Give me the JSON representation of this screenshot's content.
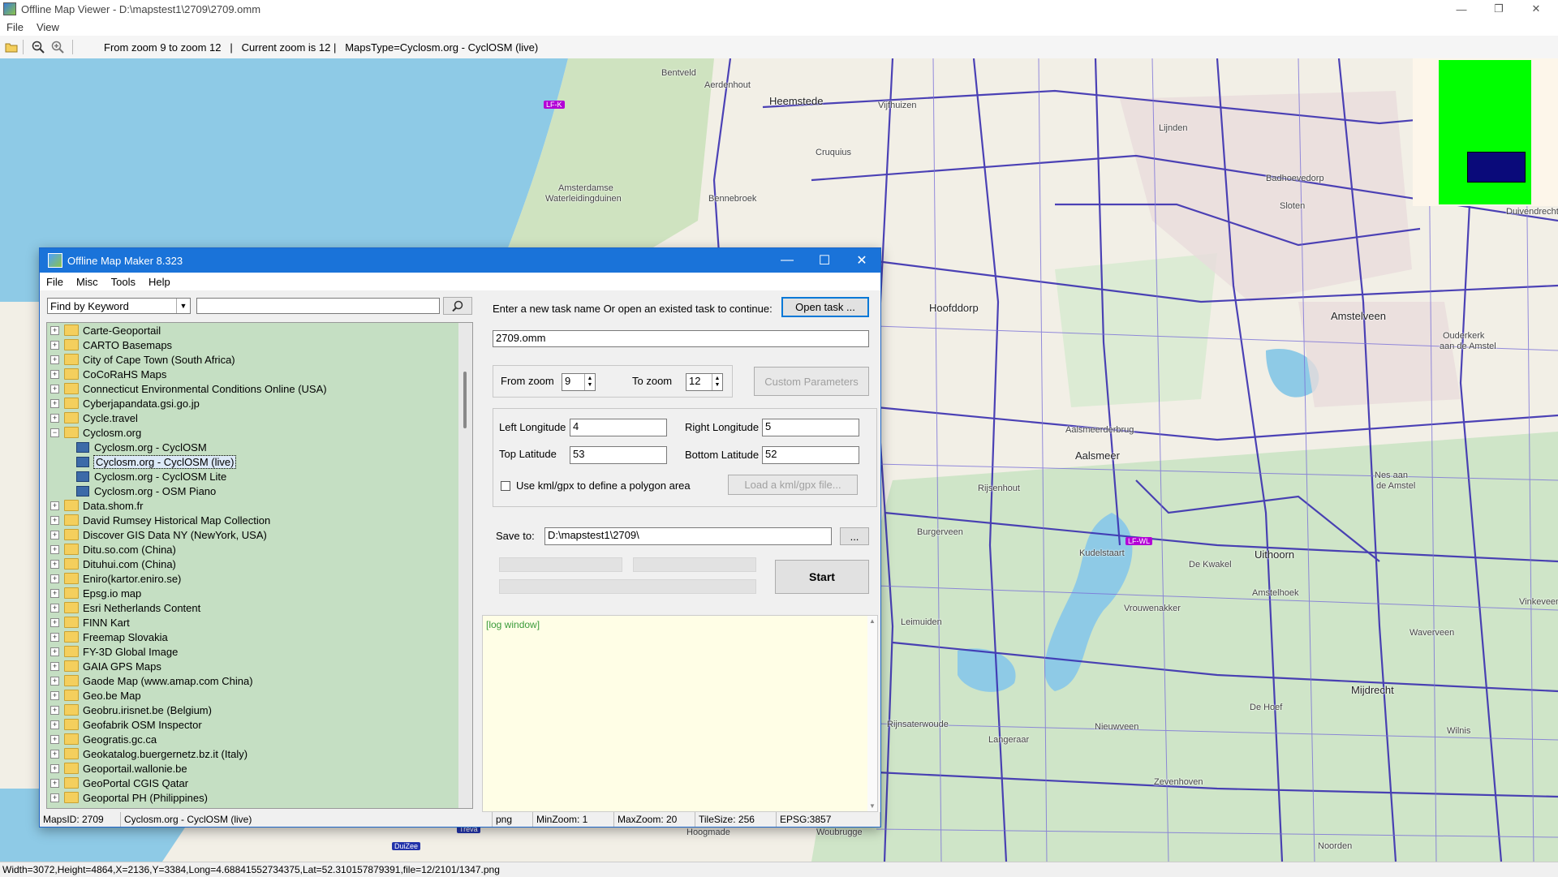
{
  "window": {
    "title": "Offline Map Viewer - D:\\mapstest1\\2709\\2709.omm",
    "controls": [
      "—",
      "❐",
      "✕"
    ]
  },
  "menu": [
    "File",
    "View"
  ],
  "toolbar": {
    "zoom_range": "From zoom 9 to zoom 12",
    "current_zoom": "Current zoom is 12",
    "map_type": "MapsType=Cyclosm.org - CyclOSM (live)"
  },
  "map": {
    "places": [
      {
        "name": "Bentveld"
      },
      {
        "name": "Aerdenhout"
      },
      {
        "name": "Heemstede"
      },
      {
        "name": "Vijfhuizen"
      },
      {
        "name": "Cruquius"
      },
      {
        "name": "Amsterdamse"
      },
      {
        "name": "Waterleidingduinen"
      },
      {
        "name": "Bennebroek"
      },
      {
        "name": "Lijnden"
      },
      {
        "name": "Badhoevedorp"
      },
      {
        "name": "Sloten"
      },
      {
        "name": "Hoofddorp"
      },
      {
        "name": "Amstelveen"
      },
      {
        "name": "Ouderkerk"
      },
      {
        "name": "aan de Amstel"
      },
      {
        "name": "Aalsmeerderbrug"
      },
      {
        "name": "Aalsmeer"
      },
      {
        "name": "Rijsenhout"
      },
      {
        "name": "Nes aan"
      },
      {
        "name": "de Amstel"
      },
      {
        "name": "Burgerveen"
      },
      {
        "name": "Kudelstaart"
      },
      {
        "name": "Uithoorn"
      },
      {
        "name": "De Kwakel"
      },
      {
        "name": "Amstelhoek"
      },
      {
        "name": "Vrouwenakker"
      },
      {
        "name": "Leimuiden"
      },
      {
        "name": "Waverveen"
      },
      {
        "name": "Vinkeveen"
      },
      {
        "name": "Mijdrecht"
      },
      {
        "name": "De Hoef"
      },
      {
        "name": "Rijnsaterwoude"
      },
      {
        "name": "Langeraar"
      },
      {
        "name": "Nieuwveen"
      },
      {
        "name": "Wilnis"
      },
      {
        "name": "Zevenhoven"
      },
      {
        "name": "Hoogmade"
      },
      {
        "name": "Woubrugge"
      },
      {
        "name": "Noorden"
      },
      {
        "name": "Duivendrecht"
      }
    ],
    "badges": [
      "LF-K",
      "LF-WL",
      "DuiZee",
      "Treva"
    ]
  },
  "statusbar": "Width=3072,Height=4864,X=2136,Y=3384,Long=4.68841552734375,Lat=52.310157879391,file=12/2101/1347.png",
  "dialog": {
    "title": "Offline Map Maker 8.323",
    "menu": [
      "File",
      "Misc",
      "Tools",
      "Help"
    ],
    "search_mode": "Find by Keyword",
    "search_value": "",
    "tree": [
      {
        "label": "Carte-Geoportail",
        "type": "folder",
        "exp": "+"
      },
      {
        "label": "CARTO Basemaps",
        "type": "folder",
        "exp": "+"
      },
      {
        "label": "City of Cape Town (South Africa)",
        "type": "folder",
        "exp": "+"
      },
      {
        "label": "CoCoRaHS Maps",
        "type": "folder",
        "exp": "+"
      },
      {
        "label": "Connecticut Environmental Conditions Online (USA)",
        "type": "folder",
        "exp": "+"
      },
      {
        "label": "Cyberjapandata.gsi.go.jp",
        "type": "folder",
        "exp": "+"
      },
      {
        "label": "Cycle.travel",
        "type": "folder",
        "exp": "+"
      },
      {
        "label": "Cyclosm.org",
        "type": "folder",
        "exp": "-"
      },
      {
        "label": "Cyclosm.org - CyclOSM",
        "type": "map"
      },
      {
        "label": "Cyclosm.org - CyclOSM (live)",
        "type": "map",
        "selected": true
      },
      {
        "label": "Cyclosm.org - CyclOSM Lite",
        "type": "map"
      },
      {
        "label": "Cyclosm.org - OSM Piano",
        "type": "map"
      },
      {
        "label": "Data.shom.fr",
        "type": "folder",
        "exp": "+"
      },
      {
        "label": "David Rumsey Historical Map Collection",
        "type": "folder",
        "exp": "+"
      },
      {
        "label": "Discover GIS Data NY (NewYork, USA)",
        "type": "folder",
        "exp": "+"
      },
      {
        "label": "Ditu.so.com (China)",
        "type": "folder",
        "exp": "+"
      },
      {
        "label": "Dituhui.com (China)",
        "type": "folder",
        "exp": "+"
      },
      {
        "label": "Eniro(kartor.eniro.se)",
        "type": "folder",
        "exp": "+"
      },
      {
        "label": "Epsg.io map",
        "type": "folder",
        "exp": "+"
      },
      {
        "label": "Esri Netherlands Content",
        "type": "folder",
        "exp": "+"
      },
      {
        "label": "FINN Kart",
        "type": "folder",
        "exp": "+"
      },
      {
        "label": "Freemap Slovakia",
        "type": "folder",
        "exp": "+"
      },
      {
        "label": "FY-3D Global Image",
        "type": "folder",
        "exp": "+"
      },
      {
        "label": "GAIA GPS Maps",
        "type": "folder",
        "exp": "+"
      },
      {
        "label": "Gaode Map (www.amap.com China)",
        "type": "folder",
        "exp": "+"
      },
      {
        "label": "Geo.be Map",
        "type": "folder",
        "exp": "+"
      },
      {
        "label": "Geobru.irisnet.be (Belgium)",
        "type": "folder",
        "exp": "+"
      },
      {
        "label": "Geofabrik OSM Inspector",
        "type": "folder",
        "exp": "+"
      },
      {
        "label": "Geogratis.gc.ca",
        "type": "folder",
        "exp": "+"
      },
      {
        "label": "Geokatalog.buergernetz.bz.it (Italy)",
        "type": "folder",
        "exp": "+"
      },
      {
        "label": "Geoportail.wallonie.be",
        "type": "folder",
        "exp": "+"
      },
      {
        "label": "GeoPortal CGIS Qatar",
        "type": "folder",
        "exp": "+"
      },
      {
        "label": "Geoportal PH (Philippines)",
        "type": "folder",
        "exp": "+"
      }
    ],
    "task_prompt": "Enter a new task name Or open an existed task to continue:",
    "open_task_label": "Open task ...",
    "task_name": "2709.omm",
    "from_zoom_label": "From zoom",
    "from_zoom": "9",
    "to_zoom_label": "To zoom",
    "to_zoom": "12",
    "custom_params_label": "Custom Parameters",
    "left_lon_label": "Left Longitude",
    "left_lon": "4",
    "right_lon_label": "Right Longitude",
    "right_lon": "5",
    "top_lat_label": "Top Latitude",
    "top_lat": "53",
    "bottom_lat_label": "Bottom Latitude",
    "bottom_lat": "52",
    "kml_checkbox_label": "Use kml/gpx to define a polygon area",
    "load_kml_label": "Load a kml/gpx file...",
    "save_to_label": "Save to:",
    "save_to": "D:\\mapstest1\\2709\\",
    "browse_label": "...",
    "start_label": "Start",
    "log_text": "[log window]",
    "status": {
      "maps_id": "MapsID: 2709",
      "map_name": "Cyclosm.org - CyclOSM (live)",
      "format": "png",
      "min_zoom": "MinZoom: 1",
      "max_zoom": "MaxZoom: 20",
      "tile_size": "TileSize: 256",
      "epsg": "EPSG:3857"
    }
  },
  "colors": {
    "accent": "#1a73d9",
    "tree_bg": "#c5dfc3",
    "log_bg": "#fffee6",
    "route": "#3a2fb0",
    "water": "#8ecae6"
  }
}
